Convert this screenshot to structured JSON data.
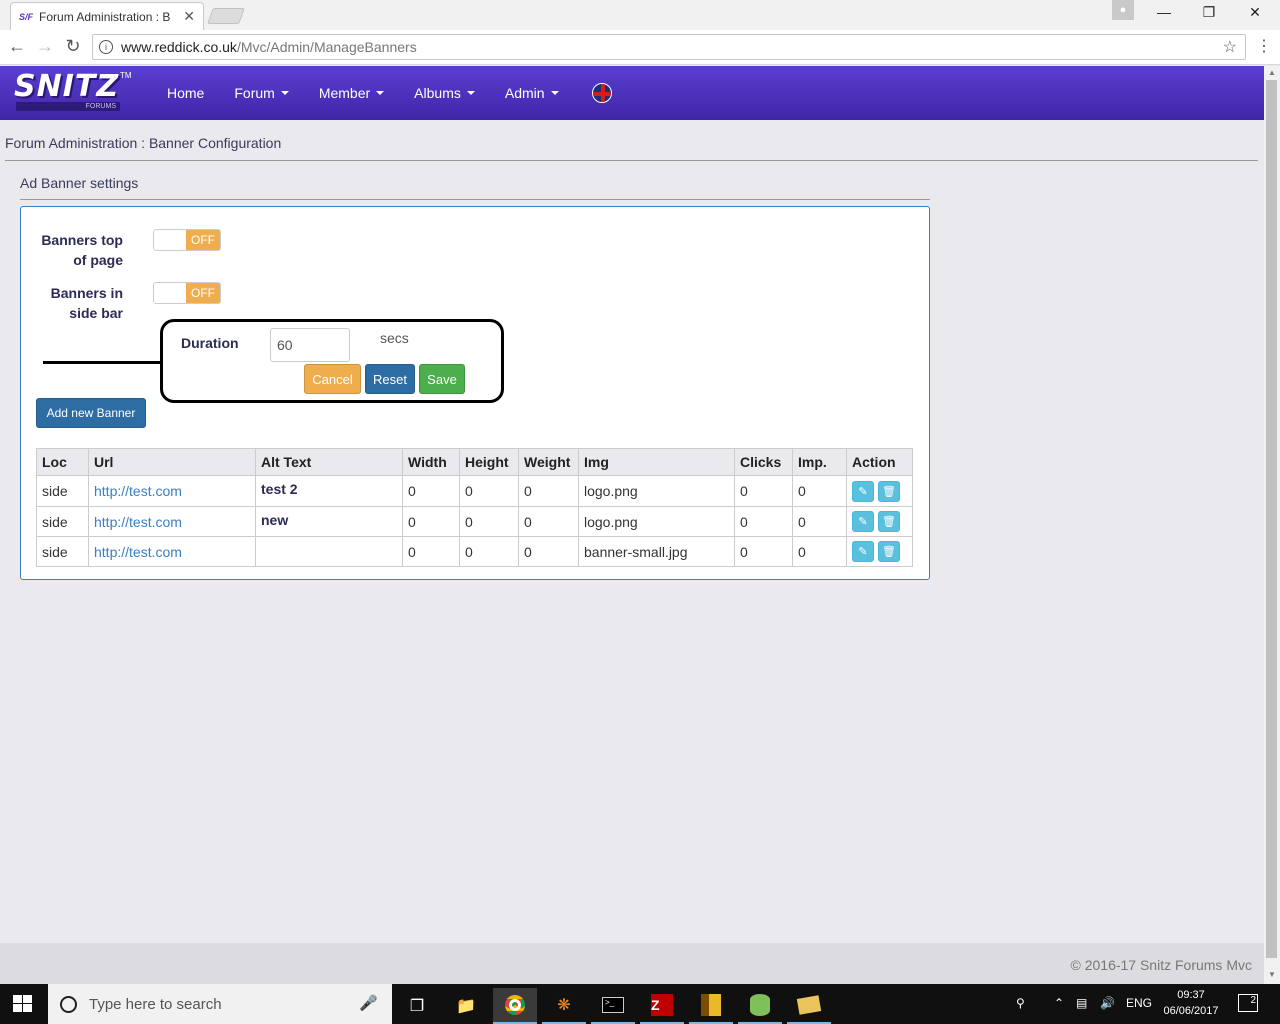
{
  "browser": {
    "tab_title": "Forum Administration : B",
    "tab_favicon": "S/F",
    "url_host": "www.reddick.co.uk",
    "url_path": "/Mvc/Admin/ManageBanners",
    "icons": [
      "back-icon",
      "forward-icon",
      "reload-icon",
      "info-icon",
      "star-icon",
      "menu-icon",
      "profile-icon",
      "minimize-icon",
      "maximize-icon",
      "close-icon"
    ]
  },
  "nav": {
    "logo_text": "SNITZ",
    "logo_sub": "FORUMS",
    "logo_tm": "TM",
    "items": [
      {
        "label": "Home",
        "dropdown": false
      },
      {
        "label": "Forum",
        "dropdown": true
      },
      {
        "label": "Member",
        "dropdown": true
      },
      {
        "label": "Albums",
        "dropdown": true
      },
      {
        "label": "Admin",
        "dropdown": true
      }
    ],
    "language_icon": "uk-flag-icon",
    "bg_color": "#4a2fc0"
  },
  "page": {
    "breadcrumb": "Forum Administration : Banner Configuration",
    "section_title": "Ad Banner settings"
  },
  "settings": {
    "top_of_page": {
      "label_line1": "Banners top",
      "label_line2": "of page",
      "state": "OFF"
    },
    "side_bar": {
      "label_line1": "Banners in",
      "label_line2": "side bar",
      "state": "OFF"
    },
    "duration": {
      "label": "Duration",
      "value": "60",
      "unit": "secs"
    },
    "buttons": {
      "cancel": "Cancel",
      "reset": "Reset",
      "save": "Save",
      "add": "Add new Banner"
    }
  },
  "table": {
    "headers": [
      "Loc",
      "Url",
      "Alt Text",
      "Width",
      "Height",
      "Weight",
      "Img",
      "Clicks",
      "Imp.",
      "Action"
    ],
    "rows": [
      {
        "loc": "side",
        "url": "http://test.com",
        "alt": "test 2",
        "width": "0",
        "height": "0",
        "weight": "0",
        "img": "logo.png",
        "clicks": "0",
        "imp": "0"
      },
      {
        "loc": "side",
        "url": "http://test.com",
        "alt": "new",
        "width": "0",
        "height": "0",
        "weight": "0",
        "img": "logo.png",
        "clicks": "0",
        "imp": "0"
      },
      {
        "loc": "side",
        "url": "http://test.com",
        "alt": "",
        "width": "0",
        "height": "0",
        "weight": "0",
        "img": "banner-small.jpg",
        "clicks": "0",
        "imp": "0"
      }
    ],
    "action_icons": [
      "pencil-icon",
      "trash-icon"
    ]
  },
  "footer": {
    "copyright": "© 2016-17 Snitz Forums Mvc"
  },
  "taskbar": {
    "search_placeholder": "Type here to search",
    "language": "ENG",
    "time": "09:37",
    "date": "06/06/2017",
    "notifications": "2"
  },
  "colors": {
    "accent_blue": "#2e6da4",
    "warning_orange": "#f0ad4e",
    "success_green": "#4cae4c",
    "info_cyan": "#5bc0de"
  }
}
